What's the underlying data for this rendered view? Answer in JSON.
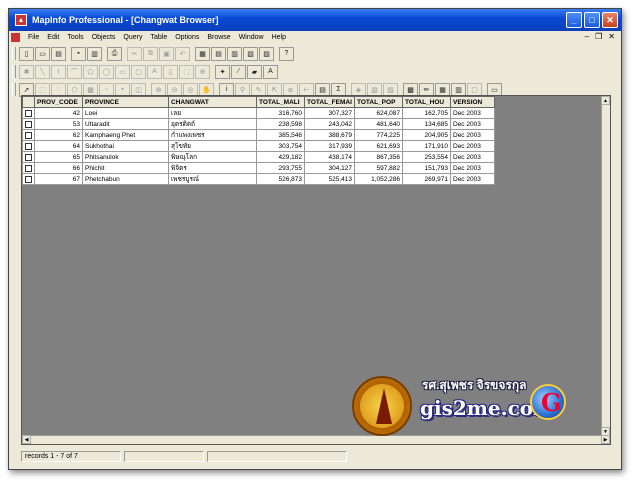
{
  "window": {
    "title": "MapInfo Professional - [Changwat Browser]"
  },
  "menu": [
    "File",
    "Edit",
    "Tools",
    "Objects",
    "Query",
    "Table",
    "Options",
    "Browse",
    "Window",
    "Help"
  ],
  "table": {
    "columns": [
      "PROV_CODE",
      "PROVINCE",
      "CHANGWAT",
      "TOTAL_MALI",
      "TOTAL_FEMAI",
      "TOTAL_POP",
      "TOTAL_HOU",
      "VERSION"
    ],
    "rows": [
      [
        "42",
        "Loei",
        "เลย",
        "316,760",
        "307,327",
        "624,087",
        "162,705",
        "Dec 2003"
      ],
      [
        "53",
        "Uttaradit",
        "อุตรดิตถ์",
        "238,598",
        "243,042",
        "481,640",
        "134,685",
        "Dec 2003"
      ],
      [
        "62",
        "Kamphaeng Phet",
        "กำแพงเพชร",
        "385,546",
        "388,679",
        "774,225",
        "204,905",
        "Dec 2003"
      ],
      [
        "64",
        "Sukhothai",
        "สุโขทัย",
        "303,754",
        "317,939",
        "621,693",
        "171,910",
        "Dec 2003"
      ],
      [
        "65",
        "Phitsanulok",
        "พิษณุโลก",
        "429,182",
        "438,174",
        "867,356",
        "253,554",
        "Dec 2003"
      ],
      [
        "66",
        "Phichit",
        "พิจิตร",
        "293,755",
        "304,127",
        "597,882",
        "151,793",
        "Dec 2003"
      ],
      [
        "67",
        "Phetchabun",
        "เพชรบูรณ์",
        "526,873",
        "525,413",
        "1,052,286",
        "269,971",
        "Dec 2003"
      ]
    ]
  },
  "status": {
    "records": "records 1 - 7 of 7"
  },
  "watermark": {
    "site": "gis2me.com",
    "thai_name": "รศ.สุเพชร จิรขจรกุล"
  },
  "colors": {
    "titlebar": "#0a4ad8",
    "workspace": "#808080",
    "chrome": "#ece9d8"
  }
}
